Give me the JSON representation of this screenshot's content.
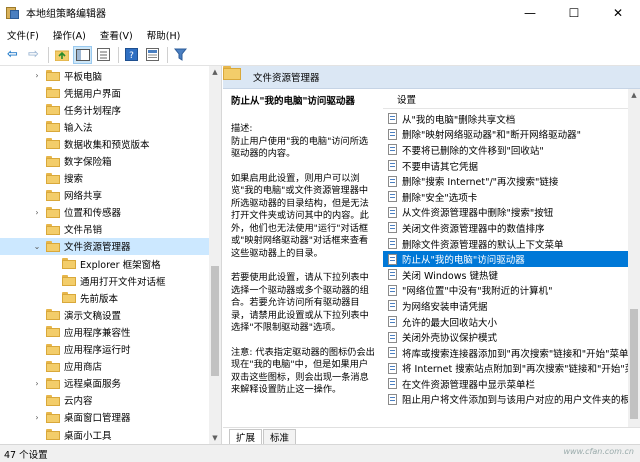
{
  "window": {
    "title": "本地组策略编辑器",
    "controls": [
      "—",
      "☐",
      "✕"
    ]
  },
  "menu": [
    "文件(F)",
    "操作(A)",
    "查看(V)",
    "帮助(H)"
  ],
  "tree": {
    "items": [
      {
        "label": "平板电脑",
        "indent": 0,
        "expand": "›"
      },
      {
        "label": "凭据用户界面",
        "indent": 0,
        "expand": ""
      },
      {
        "label": "任务计划程序",
        "indent": 0,
        "expand": ""
      },
      {
        "label": "输入法",
        "indent": 0,
        "expand": ""
      },
      {
        "label": "数据收集和预览版本",
        "indent": 0,
        "expand": ""
      },
      {
        "label": "数字保险箱",
        "indent": 0,
        "expand": ""
      },
      {
        "label": "搜索",
        "indent": 0,
        "expand": ""
      },
      {
        "label": "网络共享",
        "indent": 0,
        "expand": ""
      },
      {
        "label": "位置和传感器",
        "indent": 0,
        "expand": "›"
      },
      {
        "label": "文件吊销",
        "indent": 0,
        "expand": ""
      },
      {
        "label": "文件资源管理器",
        "indent": 0,
        "expand": "⌄",
        "selected": true
      },
      {
        "label": "Explorer 框架窗格",
        "indent": 1,
        "expand": ""
      },
      {
        "label": "通用打开文件对话框",
        "indent": 1,
        "expand": ""
      },
      {
        "label": "先前版本",
        "indent": 1,
        "expand": ""
      },
      {
        "label": "演示文稿设置",
        "indent": 0,
        "expand": ""
      },
      {
        "label": "应用程序兼容性",
        "indent": 0,
        "expand": ""
      },
      {
        "label": "应用程序运行时",
        "indent": 0,
        "expand": ""
      },
      {
        "label": "应用商店",
        "indent": 0,
        "expand": ""
      },
      {
        "label": "远程桌面服务",
        "indent": 0,
        "expand": "›"
      },
      {
        "label": "云内容",
        "indent": 0,
        "expand": ""
      },
      {
        "label": "桌面窗口管理器",
        "indent": 0,
        "expand": "›"
      },
      {
        "label": "桌面小工具",
        "indent": 0,
        "expand": ""
      },
      {
        "label": "自动播放策略",
        "indent": 0,
        "expand": ""
      }
    ]
  },
  "right": {
    "header": "文件资源管理器",
    "description": {
      "title": "防止从\"我的电脑\"访问驱动器",
      "paragraphs": [
        "描述:\n防止用户使用\"我的电脑\"访问所选驱动器的内容。",
        "如果启用此设置，则用户可以浏览\"我的电脑\"或文件资源管理器中所选驱动器的目录结构，但是无法打开文件夹或访问其中的内容。此外，他们也无法使用\"运行\"对话框或\"映射网络驱动器\"对话框来查看这些驱动器上的目录。",
        "若要使用此设置，请从下拉列表中选择一个驱动器或多个驱动器的组合。若要允许访问所有驱动器目录，请禁用此设置或从下拉列表中选择\"不限制驱动器\"选项。",
        "注意: 代表指定驱动器的图标仍会出现在\"我的电脑\"中，但是如果用户双击这些图标，则会出现一条消息来解释设置防止这一操作。"
      ]
    },
    "list_header": "设置",
    "settings": [
      "从\"我的电脑\"删除共享文档",
      "删除\"映射网络驱动器\"和\"断开网络驱动器\"",
      "不要将已删除的文件移到\"回收站\"",
      "不要申请其它凭据",
      "删除\"搜索 Internet\"/\"再次搜索\"链接",
      "删除\"安全\"选项卡",
      "从文件资源管理器中删除\"搜索\"按钮",
      "关闭文件资源管理器中的数值排序",
      "删除文件资源管理器的默认上下文菜单",
      "防止从\"我的电脑\"访问驱动器",
      "关闭 Windows 键热键",
      "\"网络位置\"中没有\"我附近的计算机\"",
      "为网络安装申请凭据",
      "允许的最大回收站大小",
      "关闭外壳协议保护模式",
      "将库或搜索连接器添加到\"再次搜索\"链接和\"开始\"菜单",
      "将 Internet 搜索站点附加到\"再次搜索\"链接和\"开始\"菜单",
      "在文件资源管理器中显示菜单栏",
      "阻止用户将文件添加到与该用户对应的用户文件夹的根目录"
    ],
    "selected_index": 9,
    "tabs": [
      "扩展",
      "标准"
    ]
  },
  "status": "47 个设置",
  "watermark": "www.cfan.com.cn"
}
